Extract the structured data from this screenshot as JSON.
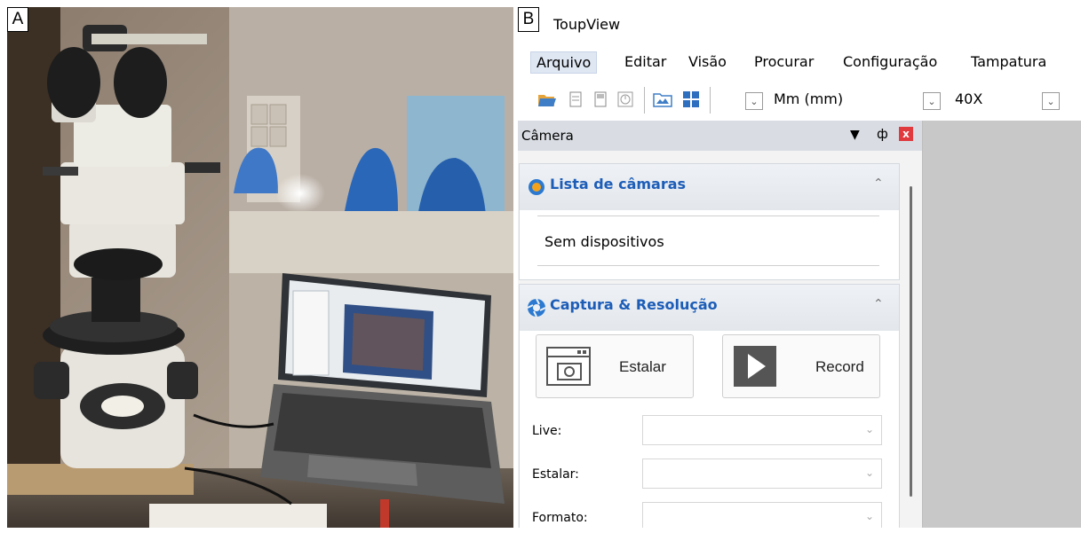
{
  "panels": {
    "a_letter": "A",
    "b_letter": "B"
  },
  "app": {
    "title": "ToupView",
    "menu": [
      "Arquivo",
      "Editar",
      "Visão",
      "Procurar",
      "Configuração",
      "Tampatura"
    ],
    "toolbar": {
      "unit": "Mm (mm)",
      "magnification": "40X"
    }
  },
  "camera_panel": {
    "title": "Câmera",
    "close_glyph": "x",
    "sections": {
      "camera_list": {
        "title": "Lista de câmaras",
        "empty_text": "Sem dispositivos"
      },
      "capture": {
        "title": "Captura & Resolução",
        "snap_button": "Estalar",
        "record_button": "Record",
        "fields": [
          {
            "label": "Live:",
            "value": ""
          },
          {
            "label": "Estalar:",
            "value": ""
          },
          {
            "label": "Formato:",
            "value": ""
          }
        ]
      }
    }
  },
  "colors": {
    "section_title": "#1c5db8",
    "close_button": "#e0393e",
    "workspace": "#c8c8c8"
  }
}
